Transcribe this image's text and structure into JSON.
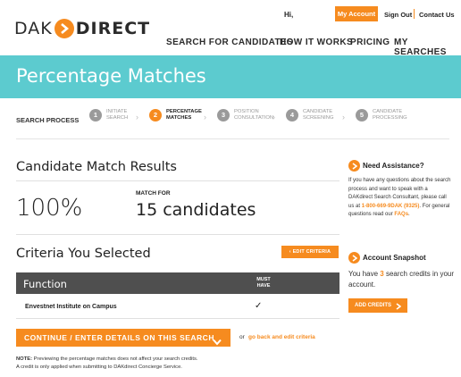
{
  "logo": {
    "part1": "DAK",
    "part2": "DIRECT"
  },
  "topbar": {
    "greeting": "Hi,",
    "my_account": "My Account",
    "sign_out": "Sign Out",
    "contact_us": "Contact Us"
  },
  "nav": {
    "items": [
      "SEARCH FOR CANDIDATES",
      "HOW IT WORKS",
      "PRICING",
      "MY SEARCHES"
    ]
  },
  "banner": {
    "title": "Percentage Matches"
  },
  "process": {
    "label": "SEARCH PROCESS",
    "steps": [
      {
        "num": "1",
        "label": "INITIATE\nSEARCH",
        "active": false
      },
      {
        "num": "2",
        "label": "PERCENTAGE\nMATCHES",
        "active": true
      },
      {
        "num": "3",
        "label": "POSITION\nCONSULTATION",
        "active": false
      },
      {
        "num": "4",
        "label": "CANDIDATE\nSCREENING",
        "active": false
      },
      {
        "num": "5",
        "label": "CANDIDATE\nPROCESSING",
        "active": false
      }
    ]
  },
  "results": {
    "title": "Candidate Match Results",
    "percent": "100%",
    "match_for_label": "MATCH FOR",
    "candidates": "15 candidates"
  },
  "criteria": {
    "title": "Criteria You Selected",
    "edit_button": "EDIT CRITERIA",
    "col_function": "Function",
    "col_must": "MUST HAVE",
    "rows": [
      {
        "name": "Envestnet Institute on Campus",
        "must": "✓"
      }
    ]
  },
  "actions": {
    "continue_label": "CONTINUE / ENTER DETAILS ON THIS SEARCH",
    "or": "or",
    "back_link": "go back and edit criteria"
  },
  "note": {
    "label": "NOTE:",
    "line1": " Previewing the percentage matches does not affect your search credits.",
    "line2": "A credit is only applied when submitting to DAKdirect Concierge Service."
  },
  "assistance": {
    "title": "Need Assistance?",
    "body_pre": "If you have any questions about the search process and want to speak with a DAKdirect Search Consultant, please call us at ",
    "phone": "1-800-669-9DAK (9325)",
    "body_mid": ". For general questions read our ",
    "faq": "FAQs",
    "body_post": "."
  },
  "snapshot": {
    "title": "Account Snapshot",
    "body_pre": "You have ",
    "credits": "3",
    "body_post": " search credits in your account.",
    "button": "ADD CREDITS"
  },
  "colors": {
    "accent": "#f68b1f",
    "banner": "#5ccbcf",
    "table_head": "#4f4f4f"
  }
}
